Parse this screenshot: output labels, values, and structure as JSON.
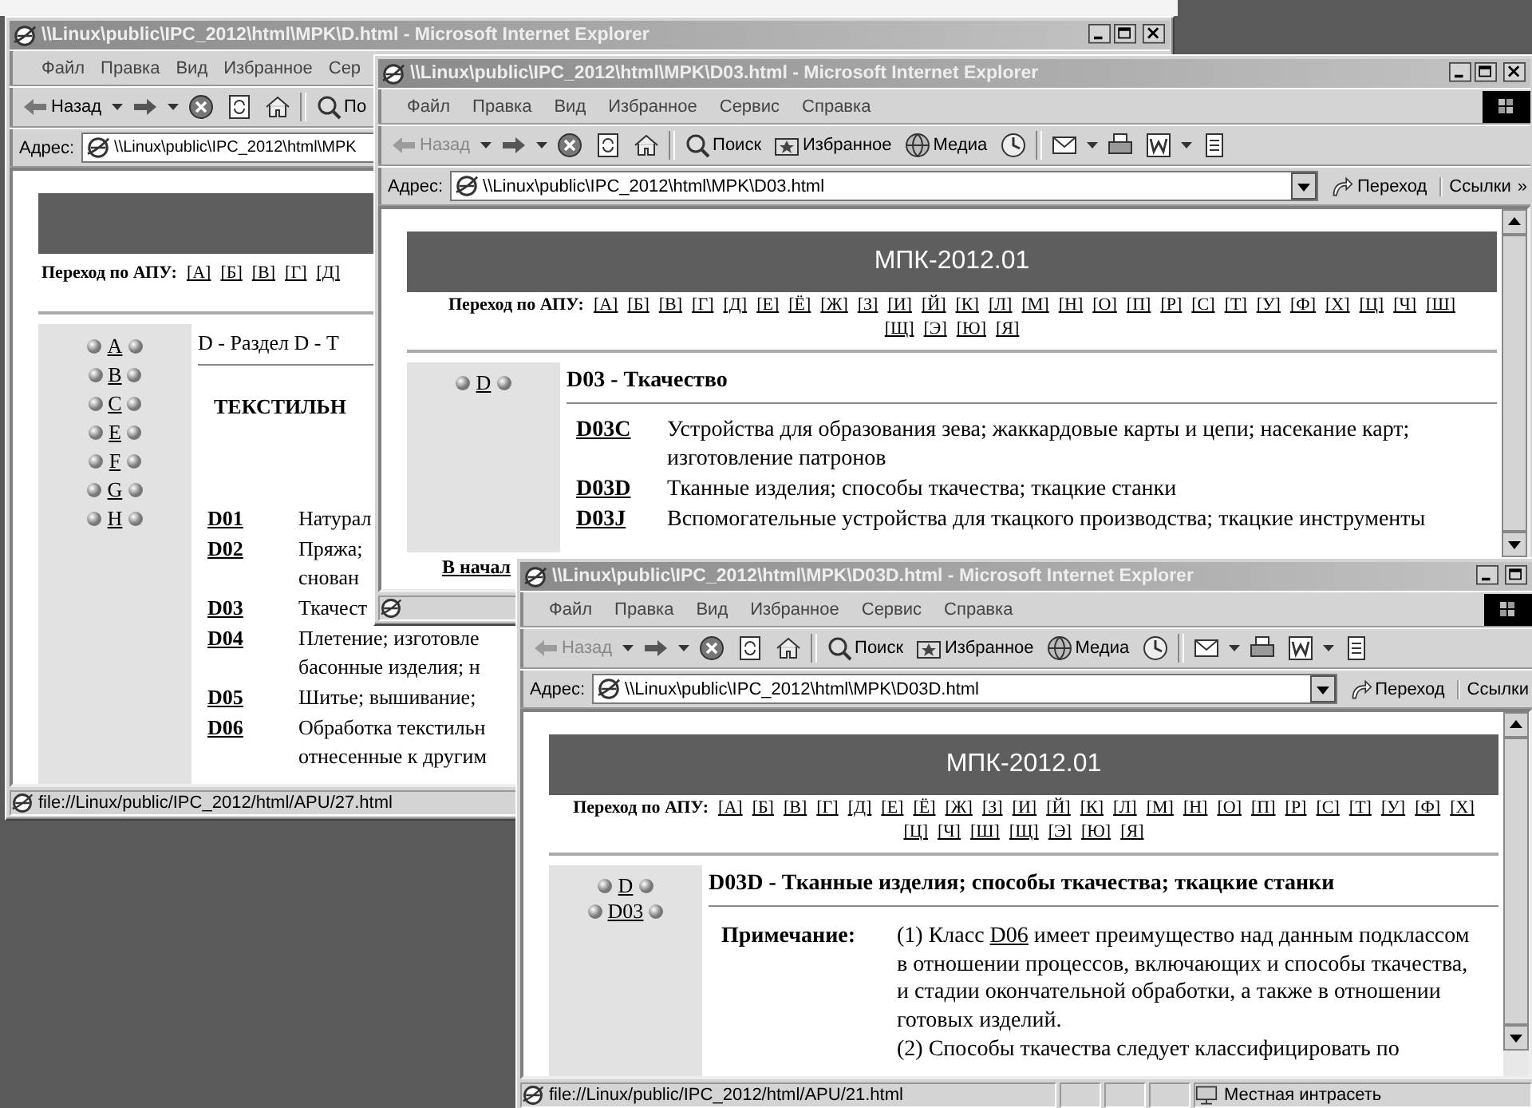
{
  "desktop": {
    "windows": [
      {
        "title": "\\\\Linux\\public\\IPC_2012\\html\\MPK\\D.html - Microsoft Internet Explorer",
        "buttons": [
          {
            "kind": "minimize"
          },
          {
            "kind": "maximize"
          },
          {
            "kind": "close"
          }
        ],
        "menu": [
          "Файл",
          "Правка",
          "Вид",
          "Избранное",
          "Сер"
        ],
        "toolbar": [
          {
            "kind": "back",
            "label": "Назад",
            "disabled": false,
            "dropdown": true
          },
          {
            "kind": "forward",
            "dropdown": true
          },
          {
            "kind": "stop"
          },
          {
            "kind": "refresh"
          },
          {
            "kind": "home"
          },
          {
            "kind": "separator"
          },
          {
            "kind": "search",
            "label": "По"
          }
        ],
        "address": {
          "label": "Адрес:",
          "value": "\\\\Linux\\public\\IPC_2012\\html\\MPK"
        },
        "page": {
          "nav": {
            "label": "Переход по АПУ:",
            "lines": [
              [
                "[А]",
                "[Б]",
                "[В]",
                "[Г]",
                "[Д]"
              ]
            ]
          },
          "sidebar": [
            [
              "A"
            ],
            [
              "B"
            ],
            [
              "C"
            ],
            [
              "E"
            ],
            [
              "F"
            ],
            [
              "G"
            ],
            [
              "H"
            ]
          ],
          "heading": "D - Раздел D - Т",
          "subheading": "ТЕКСТИЛЬН",
          "entries": [
            {
              "code": "D01",
              "lines": [
                "Натурал"
              ]
            },
            {
              "code": "D02",
              "lines": [
                "Пряжа;",
                "снован"
              ]
            },
            {
              "code": "D03",
              "lines": [
                "Ткачест"
              ]
            },
            {
              "code": "D04",
              "lines": [
                "Плетение; изготовле",
                "басонные изделия; н"
              ]
            },
            {
              "code": "D05",
              "lines": [
                "Шитье; вышивание;"
              ]
            },
            {
              "code": "D06",
              "lines": [
                "Обработка текстильн",
                "отнесенные к другим"
              ]
            }
          ]
        },
        "status": {
          "text": "file://Linux/public/IPC_2012/html/APU/27.html"
        }
      },
      {
        "title": "\\\\Linux\\public\\IPC_2012\\html\\MPK\\D03.html - Microsoft Internet Explorer",
        "buttons": [
          {
            "kind": "minimize"
          },
          {
            "kind": "maximize"
          },
          {
            "kind": "close"
          }
        ],
        "menu": [
          "Файл",
          "Правка",
          "Вид",
          "Избранное",
          "Сервис",
          "Справка"
        ],
        "logo": true,
        "toolbar": [
          {
            "kind": "back",
            "label": "Назад",
            "disabled": true,
            "dropdown": true
          },
          {
            "kind": "forward",
            "dropdown": true
          },
          {
            "kind": "stop"
          },
          {
            "kind": "refresh"
          },
          {
            "kind": "home"
          },
          {
            "kind": "separator"
          },
          {
            "kind": "search",
            "label": "Поиск"
          },
          {
            "kind": "favorites",
            "label": "Избранное"
          },
          {
            "kind": "media",
            "label": "Медиа"
          },
          {
            "kind": "history"
          },
          {
            "kind": "separator"
          },
          {
            "kind": "mail",
            "dropdown": true
          },
          {
            "kind": "print"
          },
          {
            "kind": "word",
            "dropdown": true
          },
          {
            "kind": "edit"
          }
        ],
        "address": {
          "label": "Адрес:",
          "value": "\\\\Linux\\public\\IPC_2012\\html\\MPK\\D03.html",
          "go": "Переход",
          "links": "Ссылки",
          "more": "»"
        },
        "scrollbar": true,
        "page": {
          "header": "МПК-2012.01",
          "nav": {
            "label": "Переход по АПУ:",
            "lines": [
              [
                "[А]",
                "[Б]",
                "[В]",
                "[Г]",
                "[Д]",
                "[Е]",
                "[Ё]",
                "[Ж]",
                "[З]",
                "[И]",
                "[Й]",
                "[К]",
                "[Л]",
                "[М]",
                "[Н]",
                "[О]",
                "[П]",
                "[Р]",
                "[С]",
                "[Т]",
                "[У]",
                "[Ф]",
                "[Х]",
                "[Ц]",
                "[Ч]",
                "[Ш]"
              ],
              [
                "[Щ]",
                "[Э]",
                "[Ю]",
                "[Я]"
              ]
            ]
          },
          "sidebar": [
            [
              "D"
            ]
          ],
          "heading": "D03 - Ткачество",
          "entries": [
            {
              "code": "D03C",
              "lines": [
                "Устройства для образования зева; жаккардовые карты и цепи; насекание карт;",
                "изготовление патронов"
              ]
            },
            {
              "code": "D03D",
              "lines": [
                "Тканные изделия; способы ткачества; ткацкие станки"
              ]
            },
            {
              "code": "D03J",
              "lines": [
                "Вспомогательные устройства для ткацкого производства; ткацкие инструменты"
              ]
            }
          ],
          "footer": "В начал"
        }
      },
      {
        "title": "\\\\Linux\\public\\IPC_2012\\html\\MPK\\D03D.html - Microsoft Internet Explorer",
        "buttons": [
          {
            "kind": "minimize"
          },
          {
            "kind": "maximize"
          }
        ],
        "menu": [
          "Файл",
          "Правка",
          "Вид",
          "Избранное",
          "Сервис",
          "Справка"
        ],
        "logo": true,
        "toolbar": [
          {
            "kind": "back",
            "label": "Назад",
            "disabled": true,
            "dropdown": true
          },
          {
            "kind": "forward",
            "dropdown": true
          },
          {
            "kind": "stop"
          },
          {
            "kind": "refresh"
          },
          {
            "kind": "home"
          },
          {
            "kind": "separator"
          },
          {
            "kind": "search",
            "label": "Поиск"
          },
          {
            "kind": "favorites",
            "label": "Избранное"
          },
          {
            "kind": "media",
            "label": "Медиа"
          },
          {
            "kind": "history"
          },
          {
            "kind": "separator"
          },
          {
            "kind": "mail",
            "dropdown": true
          },
          {
            "kind": "print"
          },
          {
            "kind": "word",
            "dropdown": true
          },
          {
            "kind": "edit"
          }
        ],
        "address": {
          "label": "Адрес:",
          "value": "\\\\Linux\\public\\IPC_2012\\html\\MPK\\D03D.html",
          "go": "Переход",
          "links": "Ссылки"
        },
        "scrollbar": true,
        "page": {
          "header": "МПК-2012.01",
          "nav": {
            "label": "Переход по АПУ:",
            "lines": [
              [
                "[А]",
                "[Б]",
                "[В]",
                "[Г]",
                "[Д]",
                "[Е]",
                "[Ё]",
                "[Ж]",
                "[З]",
                "[И]",
                "[Й]",
                "[К]",
                "[Л]",
                "[М]",
                "[Н]",
                "[О]",
                "[П]",
                "[Р]",
                "[С]",
                "[Т]",
                "[У]",
                "[Ф]",
                "[Х]"
              ],
              [
                "[Ц]",
                "[Ч]",
                "[Ш]",
                "[Щ]",
                "[Э]",
                "[Ю]",
                "[Я]"
              ]
            ]
          },
          "sidebar": [
            [
              "D"
            ],
            [
              "D03"
            ]
          ],
          "heading": "D03D - Тканные изделия; способы ткачества; ткацкие станки",
          "note": {
            "label": "Примечание:",
            "paragraphs": [
              [
                {
                  "text": "(1) Класс "
                },
                {
                  "link": "D06"
                },
                {
                  "text": " имеет преимущество над данным подклассом\nв отношении процессов, включающих и способы ткачества,\nи стадии окончательной обработки, а также в отношении\nготовых изделий."
                }
              ],
              [
                {
                  "text": "(2) Способы ткачества следует классифицировать по"
                }
              ]
            ]
          }
        },
        "status": {
          "text": "file://Linux/public/IPC_2012/html/APU/21.html",
          "zone": "Местная интрасеть"
        }
      }
    ]
  }
}
